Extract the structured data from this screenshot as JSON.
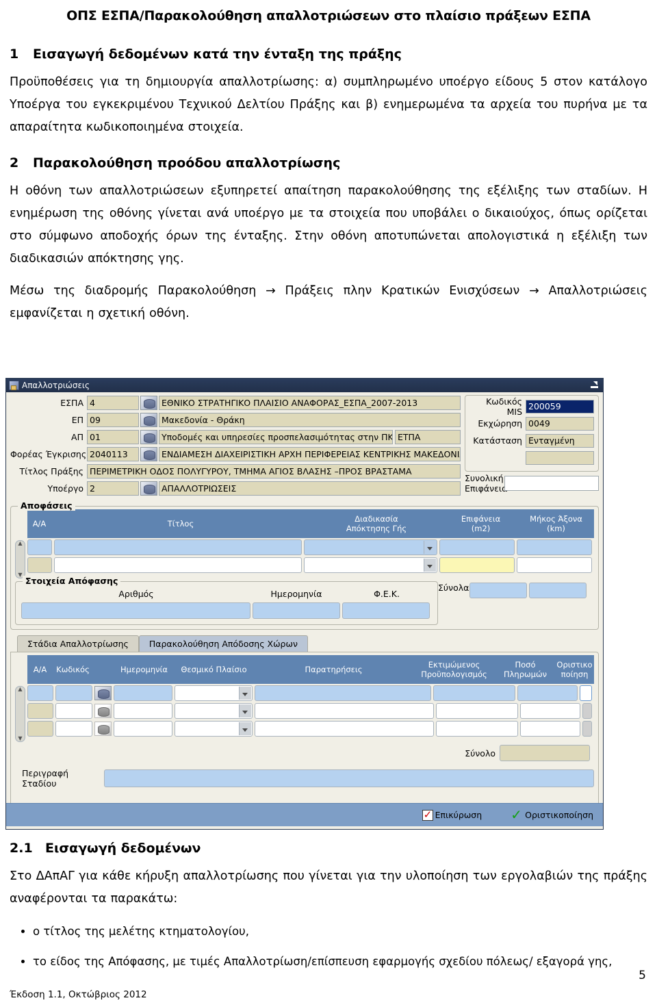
{
  "document": {
    "header_title": "ΟΠΣ ΕΣΠΑ/Παρακολούθηση απαλλοτριώσεων στο πλαίσιο πράξεων ΕΣΠΑ",
    "section1": {
      "number": "1",
      "title": "Εισαγωγή δεδομένων κατά την ένταξη της πράξης",
      "paragraph": "Προϋποθέσεις για τη δημιουργία απαλλοτρίωσης: α) συμπληρωμένο υποέργο είδους 5 στον κατάλογο Υποέργα του εγκεκριμένου Τεχνικού Δελτίου Πράξης και β) ενημερωμένα τα αρχεία του πυρήνα με τα απαραίτητα κωδικοποιημένα στοιχεία."
    },
    "section2": {
      "number": "2",
      "title": "Παρακολούθηση προόδου απαλλοτρίωσης",
      "paragraph1": "Η οθόνη των απαλλοτριώσεων εξυπηρετεί απαίτηση παρακολούθησης της εξέλιξης των σταδίων. Η ενημέρωση της οθόνης γίνεται ανά υποέργο με τα στοιχεία που υποβάλει ο δικαιούχος, όπως ορίζεται στο σύμφωνο αποδοχής όρων της ένταξης. Στην οθόνη αποτυπώνεται απολογιστικά η εξέλιξη των διαδικασιών απόκτησης γης.",
      "paragraph2": "Μέσω της διαδρομής Παρακολούθηση → Πράξεις πλην Κρατικών Ενισχύσεων → Απαλλοτριώσεις εμφανίζεται η σχετική οθόνη."
    },
    "section21": {
      "number": "2.1",
      "title": "Εισαγωγή δεδομένων",
      "paragraph": "Στο ΔΑπΑΓ για κάθε κήρυξη απαλλοτρίωσης που γίνεται για την υλοποίηση των εργολαβιών της πράξης αναφέρονται τα παρακάτω:",
      "bullets": [
        "ο τίτλος της μελέτης κτηματολογίου,",
        "το είδος της Απόφασης, με τιμές Απαλλοτρίωση/επίσπευση εφαρμογής σχεδίου πόλεως/ εξαγορά γης,"
      ]
    },
    "page_number": "5",
    "footer": "Έκδοση 1.1, Οκτώβριος 2012"
  },
  "app": {
    "window_title": "Απαλλοτριώσεις",
    "header_fields": [
      {
        "label": "ΕΣΠΑ",
        "code": "4",
        "desc": "ΕΘΝΙΚΟ ΣΤΡΑΤΗΓΙΚΟ ΠΛΑΙΣΙΟ ΑΝΑΦΟΡΑΣ_ΕΣΠΑ_2007-2013"
      },
      {
        "label": "ΕΠ",
        "code": "09",
        "desc": "Μακεδονία - Θράκη"
      },
      {
        "label": "ΑΠ",
        "code": "01",
        "desc": "Υποδομές και υπηρεσίες προσπελασιμότητας στην ΠΚΜ",
        "extra": "ΕΤΠΑ"
      },
      {
        "label": "Φορέας Έγκρισης",
        "code": "2040113",
        "desc": "ΕΝΔΙΑΜΕΣΗ ΔΙΑΧΕΙΡΙΣΤΙΚΗ ΑΡΧΗ ΠΕΡΙΦΕΡΕΙΑΣ ΚΕΝΤΡΙΚΗΣ ΜΑΚΕΔΟΝΙΑΣ"
      },
      {
        "label": "Τίτλος Πράξης",
        "code": "",
        "desc": "ΠΕΡΙΜΕΤΡΙΚΗ ΟΔΟΣ ΠΟΛΥΓΥΡΟΥ, ΤΜΗΜΑ ΑΓΙΟΣ ΒΛΑΣΗΣ –ΠΡΟΣ ΒΡΑΣΤΑΜΑ"
      },
      {
        "label": "Υποέργο",
        "code": "2",
        "desc": "ΑΠΑΛΛΟΤΡΙΩΣΕΙΣ"
      }
    ],
    "info_panel": {
      "mis_label": "Κωδικός MIS",
      "mis_value": "200059",
      "assign_label": "Εκχώρηση",
      "assign_value": "0049",
      "status_label": "Κατάσταση",
      "status_value": "Ενταγμένη",
      "blank_value": ""
    },
    "total_area": {
      "label_line1": "Συνολική",
      "label_line2": "Επιφάνεια",
      "value": ""
    },
    "decisions_group": {
      "legend": "Αποφάσεις",
      "columns": [
        {
          "line1": "",
          "line2": "Α/Α"
        },
        {
          "line1": "",
          "line2": "Τίτλος"
        },
        {
          "line1": "Διαδικασία",
          "line2": "Απόκτησης Γής"
        },
        {
          "line1": "Επιφάνεια",
          "line2": "(m2)"
        },
        {
          "line1": "Μήκος Άξονα",
          "line2": "(km)"
        }
      ],
      "totals_label": "Σύνολα",
      "decision_details": {
        "legend": "Στοιχεία Απόφασης",
        "fields": [
          "Αριθμός",
          "Ημερομηνία",
          "Φ.Ε.Κ."
        ]
      }
    },
    "tabs": [
      {
        "label": "Στάδια Απαλλοτρίωσης",
        "active": false
      },
      {
        "label": "Παρακολούθηση Απόδοσης Χώρων",
        "active": true
      }
    ],
    "stages_table": {
      "columns": [
        {
          "line1": "",
          "line2": "Α/Α"
        },
        {
          "line1": "",
          "line2": "Κωδικός"
        },
        {
          "line1": "",
          "line2": ""
        },
        {
          "line1": "",
          "line2": "Ημερομηνία"
        },
        {
          "line1": "",
          "line2": "Θεσμικό Πλαίσιο"
        },
        {
          "line1": "",
          "line2": "Παρατηρήσεις"
        },
        {
          "line1": "Εκτιμώμενος",
          "line2": "Προϋπολογισμός"
        },
        {
          "line1": "Ποσό",
          "line2": "Πληρωμών"
        },
        {
          "line1": "Οριστικο",
          "line2": "ποίηση"
        }
      ],
      "total_label": "Σύνολο",
      "stage_desc_label": "Περιγραφή Σταδίου"
    },
    "bottom_buttons": [
      {
        "label": "Επικύρωση",
        "icon": "validate-icon"
      },
      {
        "label": "Οριστικοποίηση",
        "icon": "finalize-icon"
      }
    ]
  }
}
